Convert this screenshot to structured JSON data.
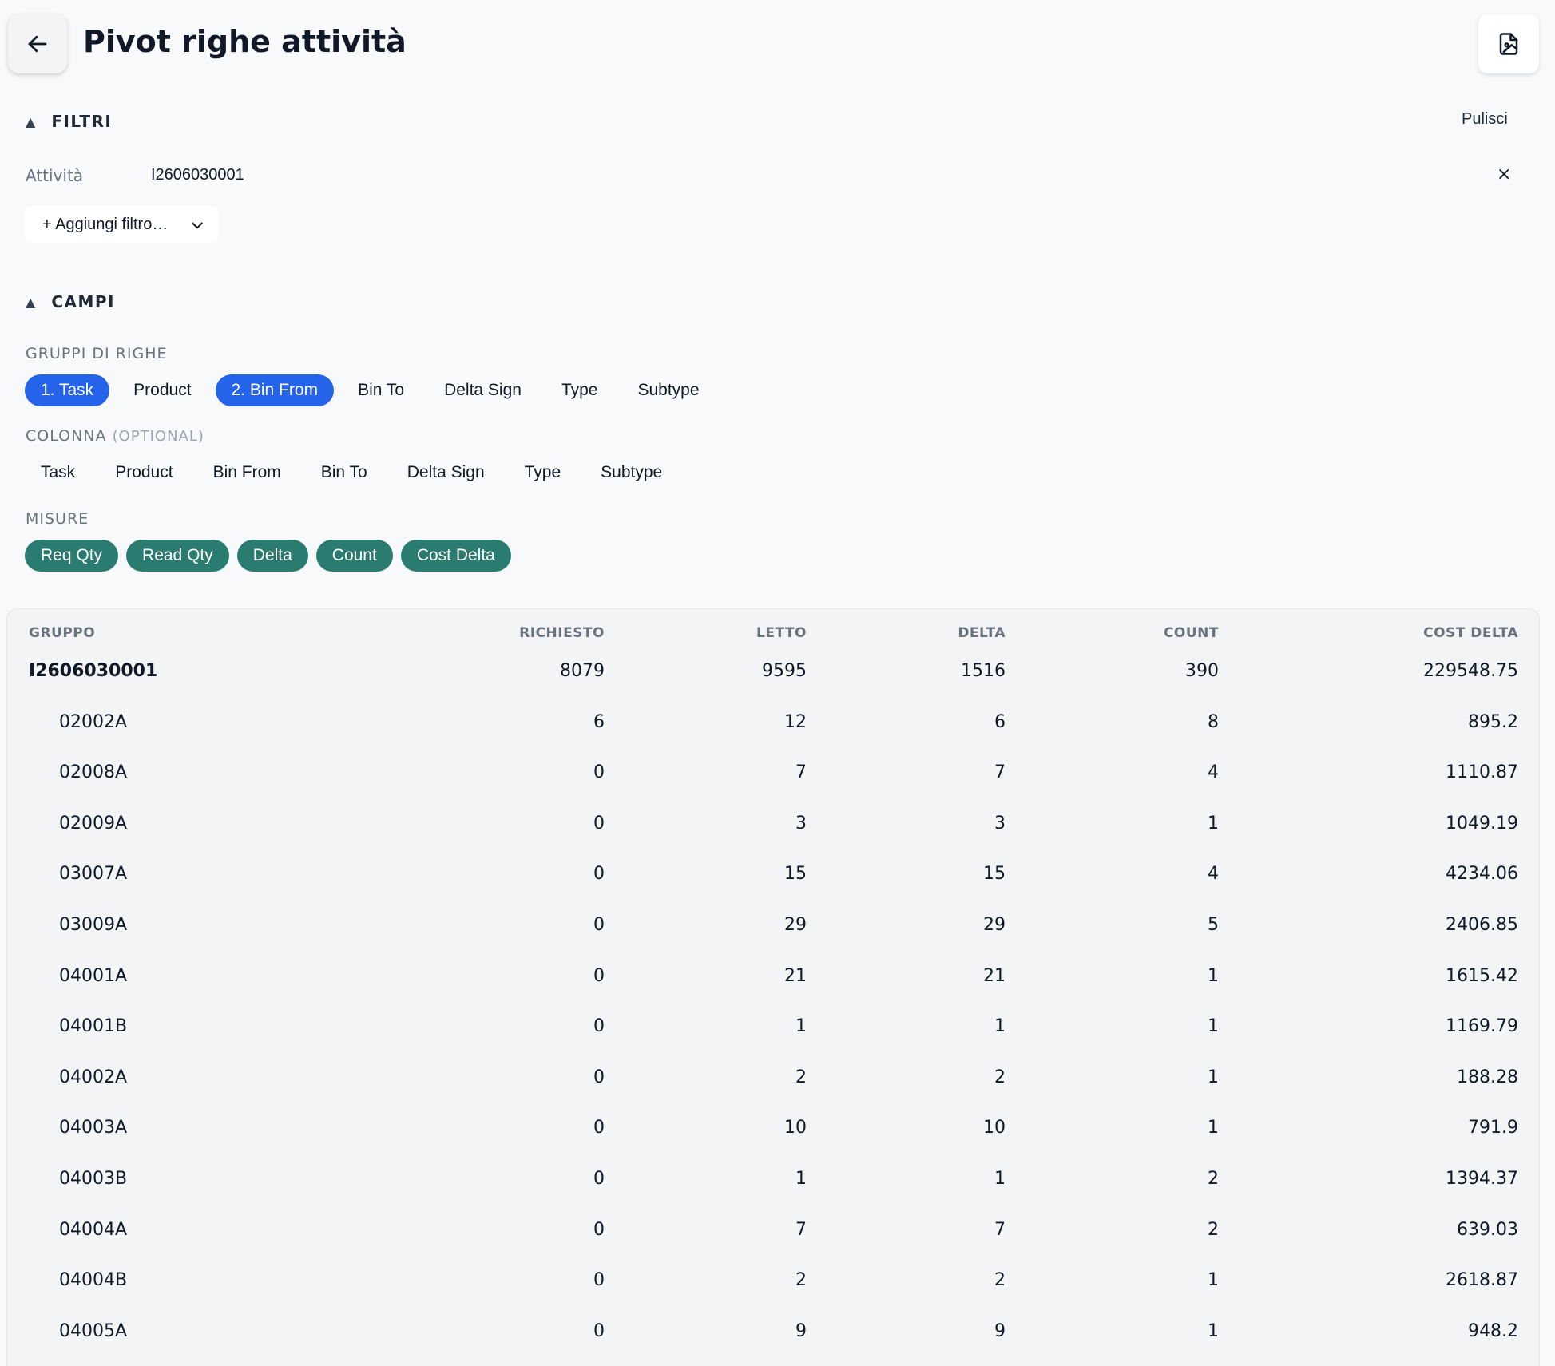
{
  "header": {
    "title": "Pivot righe attività"
  },
  "filters": {
    "section_label": "FILTRI",
    "clear_label": "Pulisci",
    "active": {
      "label": "Attività",
      "value": "I2606030001",
      "remove_label": "×"
    },
    "add_label": "+ Aggiungi filtro…"
  },
  "fields": {
    "section_label": "CAMPI",
    "row_groups": {
      "label": "GRUPPI DI RIGHE",
      "chips": [
        {
          "label": "1. Task",
          "selected": true
        },
        {
          "label": "Product",
          "selected": false
        },
        {
          "label": "2. Bin From",
          "selected": true
        },
        {
          "label": "Bin To",
          "selected": false
        },
        {
          "label": "Delta Sign",
          "selected": false
        },
        {
          "label": "Type",
          "selected": false
        },
        {
          "label": "Subtype",
          "selected": false
        }
      ]
    },
    "column": {
      "label": "COLONNA",
      "optional_label": "(OPTIONAL)",
      "chips": [
        "Task",
        "Product",
        "Bin From",
        "Bin To",
        "Delta Sign",
        "Type",
        "Subtype"
      ]
    },
    "measures": {
      "label": "MISURE",
      "chips": [
        "Req Qty",
        "Read Qty",
        "Delta",
        "Count",
        "Cost Delta"
      ]
    }
  },
  "table": {
    "headers": [
      "GRUPPO",
      "RICHIESTO",
      "LETTO",
      "DELTA",
      "COUNT",
      "COST DELTA"
    ],
    "rows": [
      {
        "level": 0,
        "cells": [
          "I2606030001",
          "8079",
          "9595",
          "1516",
          "390",
          "229548.75"
        ]
      },
      {
        "level": 1,
        "cells": [
          "02002A",
          "6",
          "12",
          "6",
          "8",
          "895.2"
        ]
      },
      {
        "level": 1,
        "cells": [
          "02008A",
          "0",
          "7",
          "7",
          "4",
          "1110.87"
        ]
      },
      {
        "level": 1,
        "cells": [
          "02009A",
          "0",
          "3",
          "3",
          "1",
          "1049.19"
        ]
      },
      {
        "level": 1,
        "cells": [
          "03007A",
          "0",
          "15",
          "15",
          "4",
          "4234.06"
        ]
      },
      {
        "level": 1,
        "cells": [
          "03009A",
          "0",
          "29",
          "29",
          "5",
          "2406.85"
        ]
      },
      {
        "level": 1,
        "cells": [
          "04001A",
          "0",
          "21",
          "21",
          "1",
          "1615.42"
        ]
      },
      {
        "level": 1,
        "cells": [
          "04001B",
          "0",
          "1",
          "1",
          "1",
          "1169.79"
        ]
      },
      {
        "level": 1,
        "cells": [
          "04002A",
          "0",
          "2",
          "2",
          "1",
          "188.28"
        ]
      },
      {
        "level": 1,
        "cells": [
          "04003A",
          "0",
          "10",
          "10",
          "1",
          "791.9"
        ]
      },
      {
        "level": 1,
        "cells": [
          "04003B",
          "0",
          "1",
          "1",
          "2",
          "1394.37"
        ]
      },
      {
        "level": 1,
        "cells": [
          "04004A",
          "0",
          "7",
          "7",
          "2",
          "639.03"
        ]
      },
      {
        "level": 1,
        "cells": [
          "04004B",
          "0",
          "2",
          "2",
          "1",
          "2618.87"
        ]
      },
      {
        "level": 1,
        "cells": [
          "04005A",
          "0",
          "9",
          "9",
          "1",
          "948.2"
        ]
      }
    ]
  }
}
